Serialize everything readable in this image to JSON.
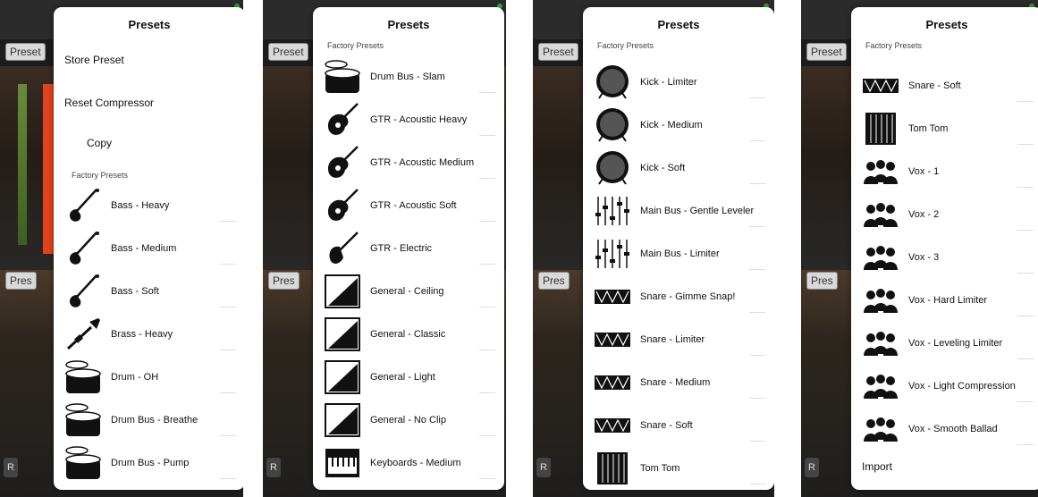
{
  "background": {
    "preset_button_label": "Preset",
    "preset_button_short": "Pres",
    "r_button_label": "R"
  },
  "panels": [
    {
      "title": "Presets",
      "commands": [
        {
          "label": "Store Preset"
        },
        {
          "label": "Reset Compressor"
        },
        {
          "label": "Copy"
        }
      ],
      "section_label": "Factory Presets",
      "items": [
        {
          "label": "Bass -  Heavy",
          "icon": "bass-guitar-icon"
        },
        {
          "label": "Bass - Medium",
          "icon": "bass-guitar-icon"
        },
        {
          "label": "Bass - Soft",
          "icon": "bass-guitar-icon"
        },
        {
          "label": "Brass - Heavy",
          "icon": "trumpet-icon"
        },
        {
          "label": "Drum - OH",
          "icon": "drum-icon"
        },
        {
          "label": "Drum Bus - Breathe",
          "icon": "drum-icon"
        },
        {
          "label": "Drum Bus - Pump",
          "icon": "drum-icon"
        }
      ]
    },
    {
      "title": "Presets",
      "section_label": "Factory Presets",
      "items": [
        {
          "label": "Drum Bus - Slam",
          "icon": "drum-icon"
        },
        {
          "label": "GTR - Acoustic Heavy",
          "icon": "acoustic-guitar-icon"
        },
        {
          "label": "GTR - Acoustic Medium",
          "icon": "acoustic-guitar-icon"
        },
        {
          "label": "GTR - Acoustic Soft",
          "icon": "acoustic-guitar-icon"
        },
        {
          "label": "GTR - Electric",
          "icon": "electric-guitar-icon"
        },
        {
          "label": "General - Ceiling",
          "icon": "curve-icon"
        },
        {
          "label": "General - Classic",
          "icon": "curve-icon"
        },
        {
          "label": "General - Light",
          "icon": "curve-icon"
        },
        {
          "label": "General - No Clip",
          "icon": "curve-icon"
        },
        {
          "label": "Keyboards - Medium",
          "icon": "keyboard-icon"
        }
      ]
    },
    {
      "title": "Presets",
      "section_label": "Factory Presets",
      "items": [
        {
          "label": "Kick - Limiter",
          "icon": "kick-drum-icon"
        },
        {
          "label": "Kick - Medium",
          "icon": "kick-drum-icon"
        },
        {
          "label": "Kick - Soft",
          "icon": "kick-drum-icon"
        },
        {
          "label": "Main Bus - Gentle Leveler",
          "icon": "fader-icon"
        },
        {
          "label": "Main Bus - Limiter",
          "icon": "fader-icon"
        },
        {
          "label": "Snare - Gimme Snap!",
          "icon": "snare-icon"
        },
        {
          "label": "Snare - Limiter",
          "icon": "snare-icon"
        },
        {
          "label": "Snare - Medium",
          "icon": "snare-icon"
        },
        {
          "label": "Snare - Soft",
          "icon": "snare-icon"
        },
        {
          "label": "Tom Tom",
          "icon": "tom-icon"
        }
      ]
    },
    {
      "title": "Presets",
      "section_label": "Factory Presets",
      "items": [
        {
          "label": "Snare - Soft",
          "icon": "snare-icon"
        },
        {
          "label": "Tom Tom",
          "icon": "tom-icon"
        },
        {
          "label": "Vox - 1",
          "icon": "vocalists-icon"
        },
        {
          "label": "Vox - 2",
          "icon": "vocalists-icon"
        },
        {
          "label": "Vox - 3",
          "icon": "vocalists-icon"
        },
        {
          "label": "Vox - Hard Limiter",
          "icon": "vocalists-icon"
        },
        {
          "label": "Vox - Leveling Limiter",
          "icon": "vocalists-icon"
        },
        {
          "label": "Vox - Light Compression",
          "icon": "vocalists-icon"
        },
        {
          "label": "Vox - Smooth Ballad",
          "icon": "vocalists-icon"
        }
      ],
      "footer_command": {
        "label": "Import"
      }
    }
  ]
}
